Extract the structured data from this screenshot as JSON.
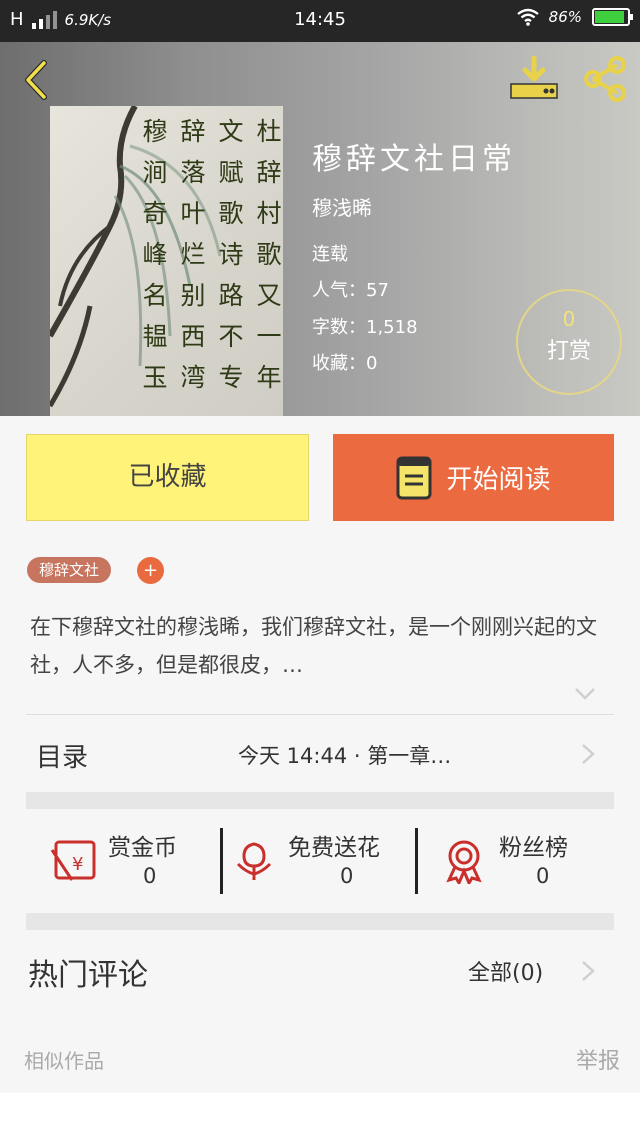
{
  "status_bar": {
    "network": "H",
    "speed": "6.9K/s",
    "time": "14:45",
    "battery": "86%"
  },
  "book": {
    "title": "穆辞文社日常",
    "author": "穆浅晞",
    "status": "连载",
    "popularity": "人气：57",
    "word_count": "字数：1,518",
    "favorites": "收藏：0",
    "tip_count": "0",
    "tip_label": "打赏",
    "cover_text": [
      "穆",
      "辞",
      "文",
      "杜",
      "涧",
      "落",
      "赋",
      "辞",
      "奇",
      "叶",
      "歌",
      "村",
      "峰",
      "烂",
      "诗",
      "歌",
      "名",
      "别",
      "路",
      "又",
      "韫",
      "西",
      "不",
      "一",
      "玉",
      "湾",
      "专",
      "年"
    ]
  },
  "actions": {
    "favorited_label": "已收藏",
    "read_label": "开始阅读"
  },
  "tags": {
    "tag1": "穆辞文社",
    "add": "+"
  },
  "intro": "在下穆辞文社的穆浅晞，我们穆辞文社，是一个刚刚兴起的文社，人不多，但是都很皮，…",
  "toc": {
    "label": "目录",
    "latest": "今天 14:44 · 第一章…"
  },
  "stats": {
    "coins_label": "赏金币",
    "coins_value": "0",
    "flowers_label": "免费送花",
    "flowers_value": "0",
    "fans_label": "粉丝榜",
    "fans_value": "0"
  },
  "comments": {
    "label": "热门评论",
    "all": "全部(0)"
  },
  "footer": {
    "similar": "相似作品",
    "report": "举报"
  },
  "colors": {
    "accent": "#eb6a3f",
    "favorite_bg": "#fff37a",
    "icon_gold": "#e8d24a",
    "icon_red": "#c9302c"
  }
}
